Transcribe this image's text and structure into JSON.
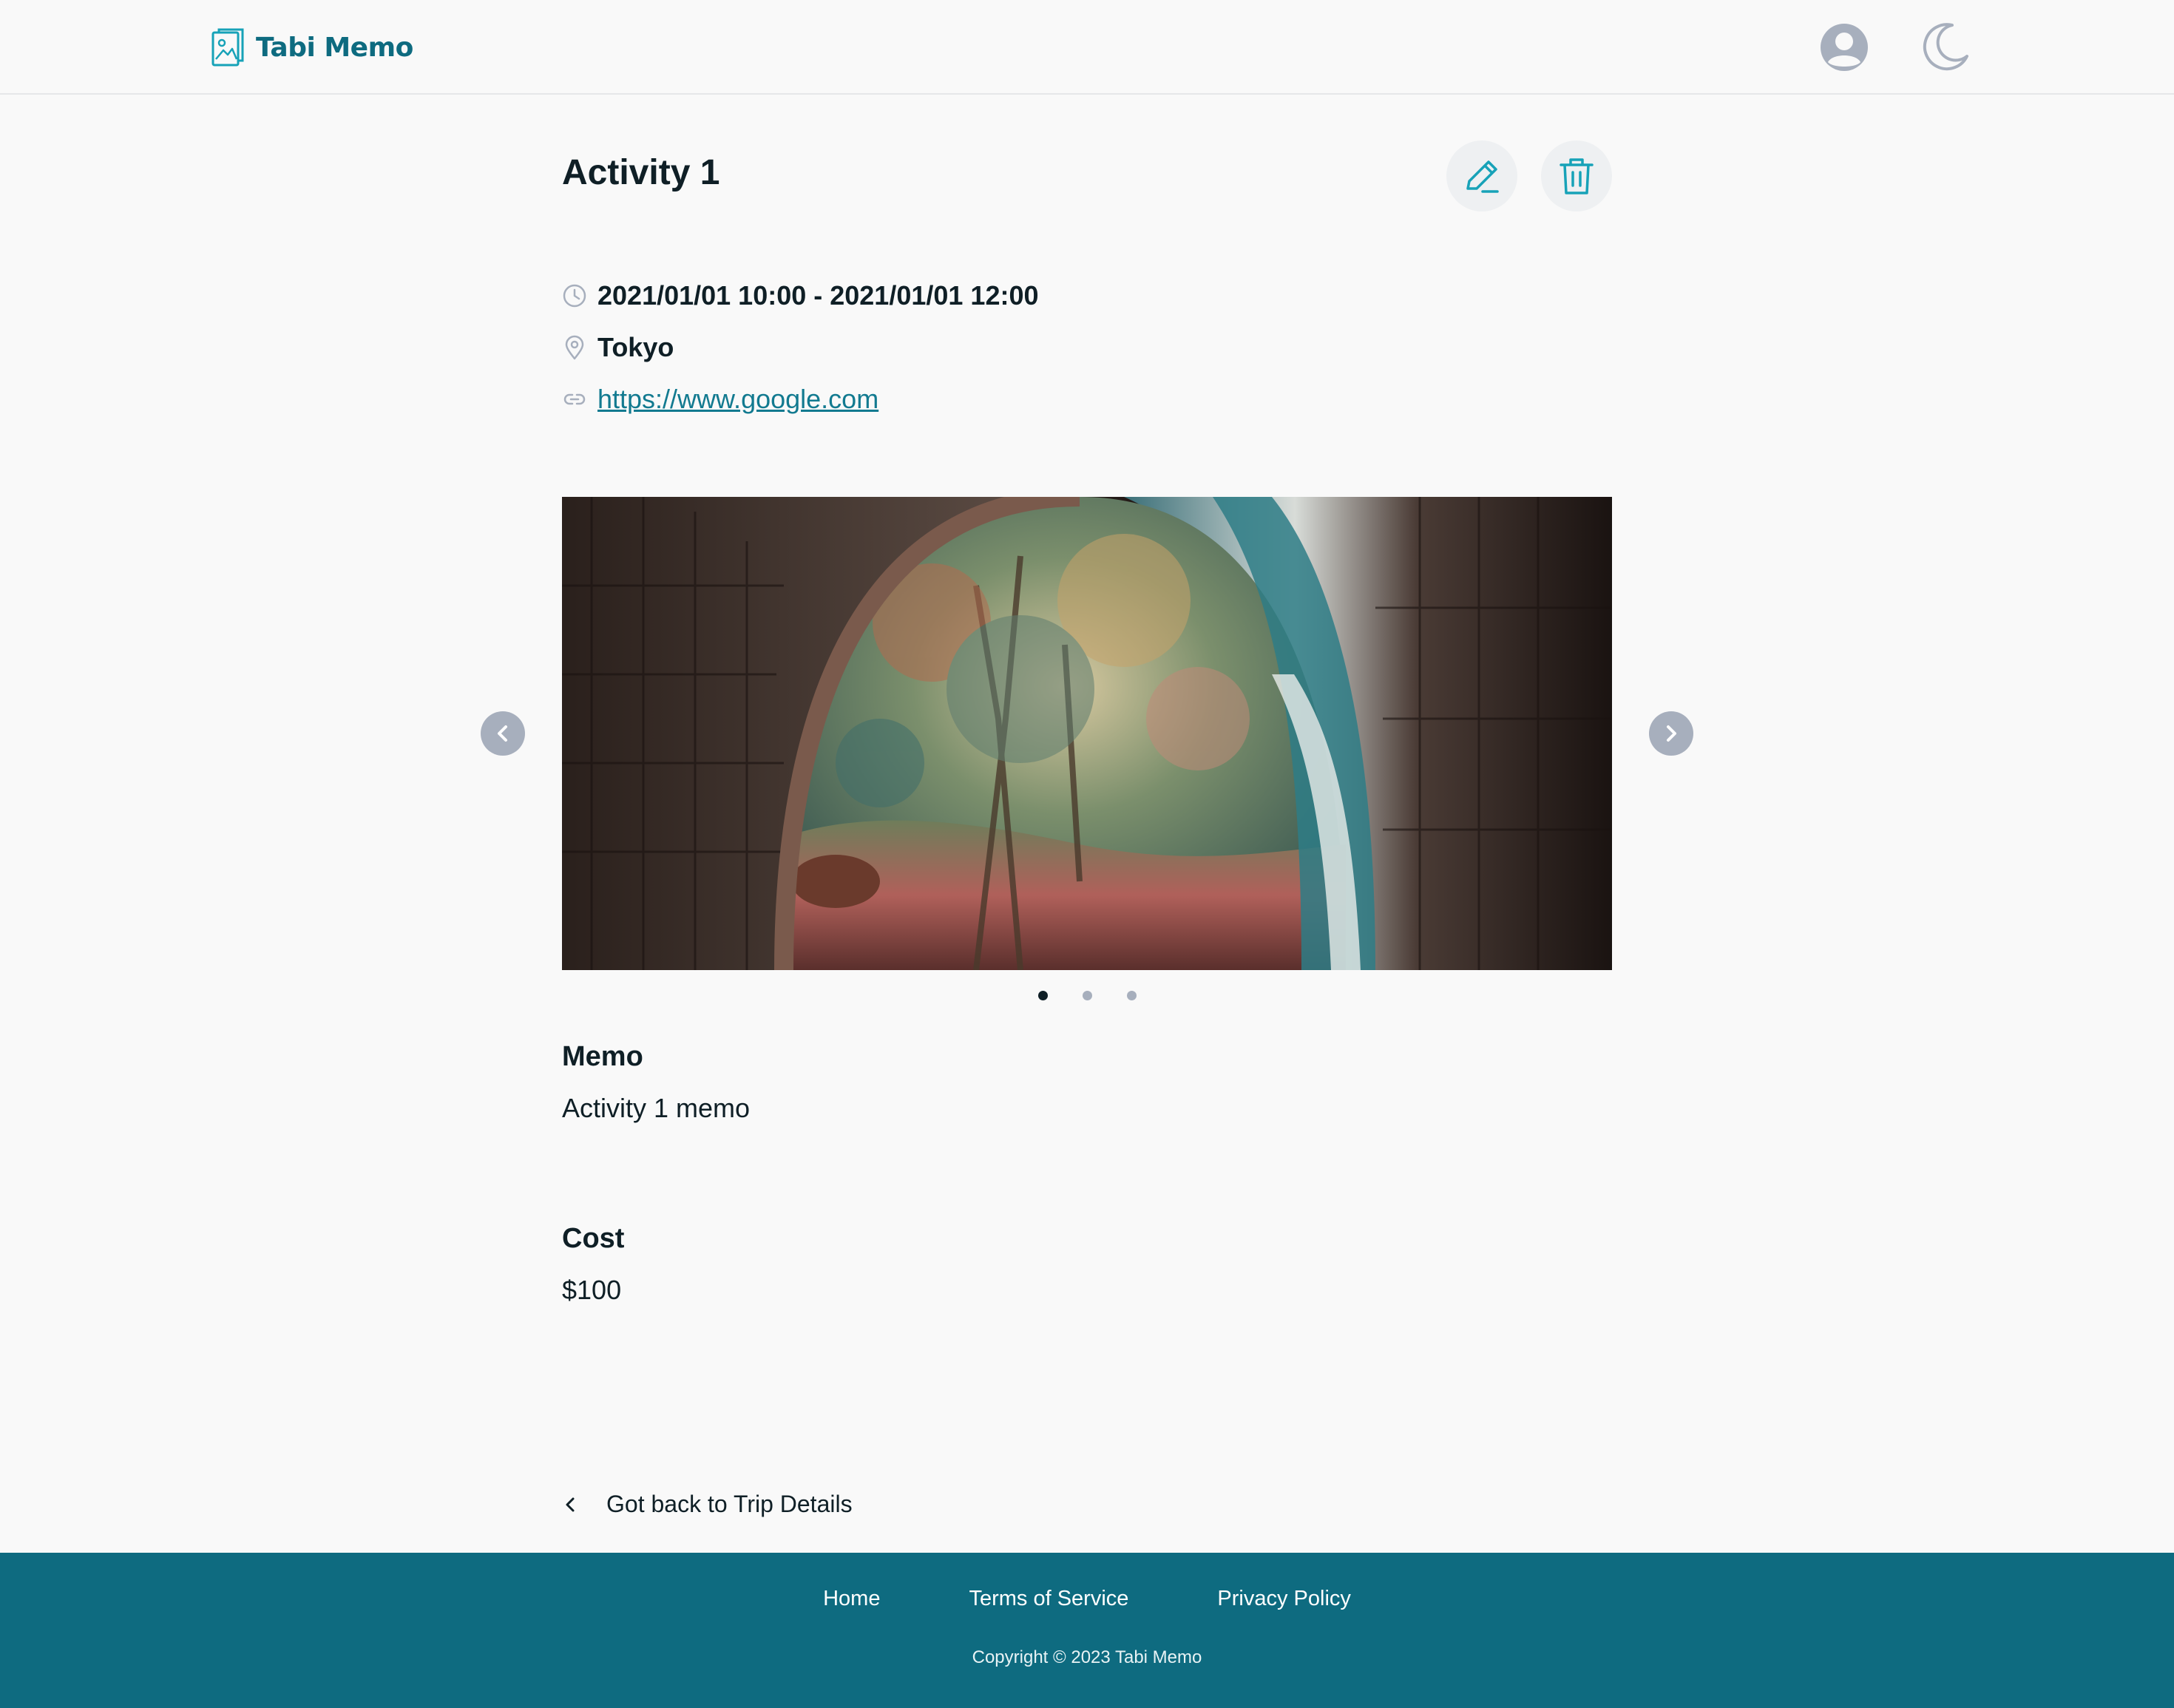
{
  "header": {
    "brand": "Tabi Memo",
    "logo_icon": "photo-album-icon",
    "user_icon": "user-circle-icon",
    "theme_icon": "moon-icon"
  },
  "activity": {
    "title": "Activity 1",
    "edit_icon": "pencil-icon",
    "delete_icon": "trash-icon",
    "datetime": "2021/01/01 10:00 - 2021/01/01 12:00",
    "location": "Tokyo",
    "url": "https://www.google.com"
  },
  "carousel": {
    "image_count": 3,
    "active_index": 0,
    "prev_icon": "chevron-left-icon",
    "next_icon": "chevron-right-icon"
  },
  "memo": {
    "label": "Memo",
    "value": "Activity 1 memo"
  },
  "cost": {
    "label": "Cost",
    "value": "$100"
  },
  "back": {
    "label": "Got back to Trip Details"
  },
  "footer": {
    "links": [
      "Home",
      "Terms of Service",
      "Privacy Policy"
    ],
    "copyright": "Copyright © 2023 Tabi Memo"
  },
  "colors": {
    "brand": "#0e6b80",
    "accent": "#17a2b8",
    "muted_icon": "#a7afbd",
    "text": "#0f1f26",
    "background": "#f9f9f9"
  }
}
